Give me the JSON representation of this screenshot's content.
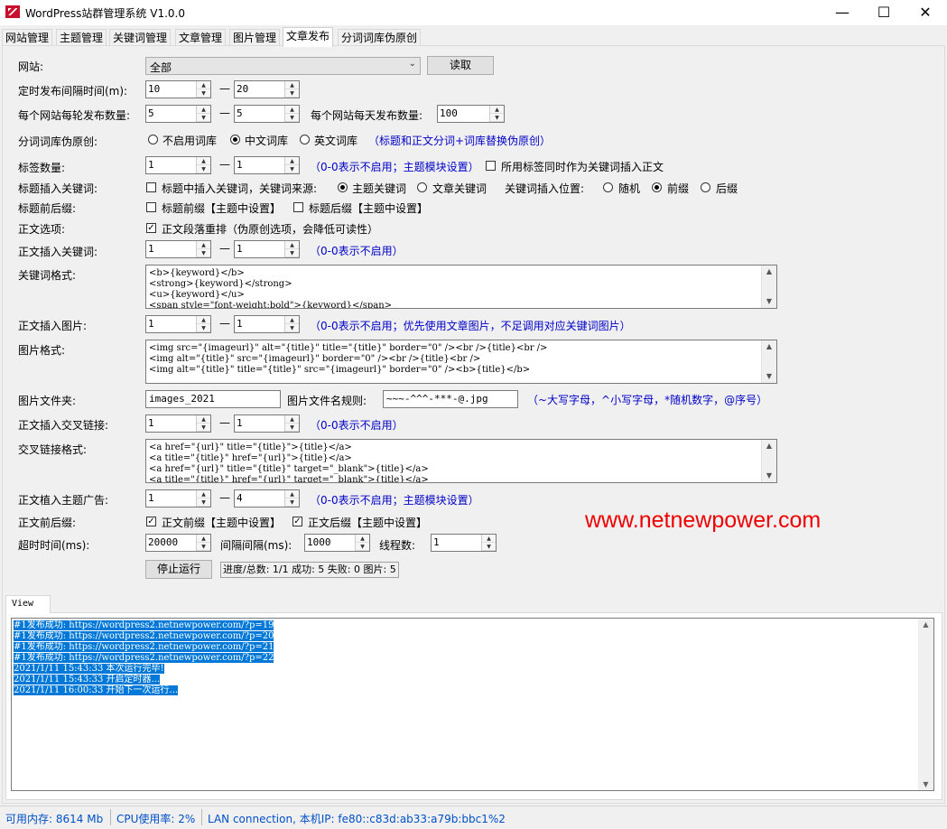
{
  "window": {
    "title": "WordPress站群管理系统 V1.0.0",
    "minimize": "—",
    "maximize": "☐",
    "close": "✕"
  },
  "tabs": [
    "网站管理",
    "主题管理",
    "关键词管理",
    "文章管理",
    "图片管理",
    "文章发布",
    "分词词库伪原创"
  ],
  "form": {
    "site_label": "网站:",
    "site_value": "全部",
    "read_button": "读取",
    "interval_label": "定时发布间隔时间(m):",
    "interval_min": "10",
    "interval_max": "20",
    "per_round_label": "每个网站每轮发布数量:",
    "per_round_min": "5",
    "per_round_max": "5",
    "per_day_label": "每个网站每天发布数量:",
    "per_day_value": "100",
    "lexicon_label": "分词词库伪原创:",
    "lexicon_opt_none": "不启用词库",
    "lexicon_opt_cn": "中文词库",
    "lexicon_opt_en": "英文词库",
    "lexicon_hint": "（标题和正文分词+词库替换伪原创）",
    "tag_count_label": "标签数量:",
    "tag_min": "1",
    "tag_max": "1",
    "tag_hint": "（0-0表示不启用；主题模块设置）",
    "tag_as_keyword": "所用标签同时作为关键词插入正文",
    "title_kw_label": "标题插入关键词:",
    "title_kw_check": "标题中插入关键词，关键词来源:",
    "title_kw_src_theme": "主题关键词",
    "title_kw_src_article": "文章关键词",
    "kw_position_label": "关键词插入位置:",
    "kw_pos_random": "随机",
    "kw_pos_prefix": "前缀",
    "kw_pos_suffix": "后缀",
    "title_affix_label": "标题前后缀:",
    "title_prefix": "标题前缀【主题中设置】",
    "title_suffix": "标题后缀【主题中设置】",
    "body_option_label": "正文选项:",
    "body_option_check": "正文段落重排（伪原创选项，会降低可读性）",
    "body_kw_label": "正文插入关键词:",
    "body_kw_min": "1",
    "body_kw_max": "1",
    "body_kw_hint": "（0-0表示不启用）",
    "kw_format_label": "关键词格式:",
    "kw_format_lines": "<b>{keyword}</b>\n<strong>{keyword}</strong>\n<u>{keyword}</u>\n<span style=\"font-weight:bold\">{keyword}</span>",
    "body_img_label": "正文插入图片:",
    "body_img_min": "1",
    "body_img_max": "1",
    "body_img_hint": "（0-0表示不启用；优先使用文章图片，不足调用对应关键词图片）",
    "img_format_label": "图片格式:",
    "img_format_lines": "<img src=\"{imageurl}\" alt=\"{title}\" title=\"{title}\" border=\"0\" /><br />{title}<br />\n<img alt=\"{title}\" src=\"{imageurl}\" border=\"0\" /><br />{title}<br />\n<img alt=\"{title}\" title=\"{title}\" src=\"{imageurl}\" border=\"0\" /><b>{title}</b>",
    "img_folder_label": "图片文件夹:",
    "img_folder_value": "images_2021",
    "img_name_rule_label": "图片文件名规则:",
    "img_name_rule_value": "~~~-^^^-***-@.jpg",
    "img_name_rule_hint": "（~大写字母，^小写字母，*随机数字，@序号）",
    "cross_link_label": "正文插入交叉链接:",
    "cross_link_min": "1",
    "cross_link_max": "1",
    "cross_link_hint": "（0-0表示不启用）",
    "cross_format_label": "交叉链接格式:",
    "cross_format_lines": "<a href=\"{url}\" title=\"{title}\">{title}</a>\n<a title=\"{title}\" href=\"{url}\">{title}</a>\n<a href=\"{url}\" title=\"{title}\" target=\"_blank\">{title}</a>\n<a title=\"{title}\" href=\"{url}\" target=\"_blank\">{title}</a>",
    "ad_label": "正文植入主题广告:",
    "ad_min": "1",
    "ad_max": "4",
    "ad_hint": "（0-0表示不启用；主题模块设置）",
    "body_affix_label": "正文前后缀:",
    "body_prefix": "正文前缀【主题中设置】",
    "body_suffix": "正文后缀【主题中设置】",
    "timeout_label": "超时时间(ms):",
    "timeout_value": "20000",
    "gap_label": "间隔间隔(ms):",
    "gap_value": "1000",
    "threads_label": "线程数:",
    "threads_value": "1",
    "stop_button": "停止运行",
    "progress": "进度/总数: 1/1 成功: 5 失败: 0 图片: 5",
    "dash": "—"
  },
  "watermark": "www.netnewpower.com",
  "view": {
    "tab": "View",
    "log": [
      "#1发布成功: https://wordpress2.netnewpower.com/?p=19",
      "#1发布成功: https://wordpress2.netnewpower.com/?p=20",
      "#1发布成功: https://wordpress2.netnewpower.com/?p=21",
      "#1发布成功: https://wordpress2.netnewpower.com/?p=22",
      "2021/1/11 15:43:33 本次运行完毕!",
      "2021/1/11 15:43:33 开启定时器...",
      "2021/1/11 16:00:33 开始下一次运行..."
    ]
  },
  "status": {
    "memory": "可用内存:  8614 Mb",
    "cpu": "CPU使用率:  2%",
    "network": "LAN connection,  本机IP: fe80::c83d:ab33:a79b:bbc1%2"
  },
  "colors": {
    "hint": "#0000c8",
    "watermark": "#ee0000",
    "status": "#0050c8",
    "selection": "#0078d7"
  }
}
